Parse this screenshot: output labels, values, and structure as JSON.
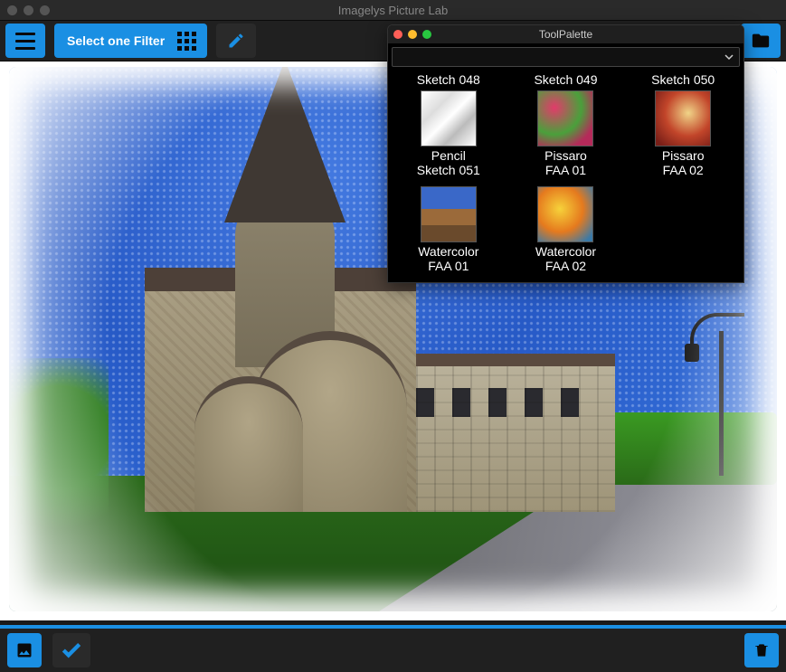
{
  "app": {
    "title": "Imagelys Picture Lab"
  },
  "toolbar": {
    "menu_icon": "hamburger-icon",
    "filter_label": "Select one Filter",
    "grid_icon": "grid-icon",
    "edit_icon": "pencil-icon",
    "folder_icon": "folder-icon"
  },
  "palette": {
    "title": "ToolPalette",
    "dropdown_value": "",
    "presets": [
      {
        "top": "Sketch 048",
        "l1": "Pencil",
        "l2": "Sketch 051",
        "thumb": "t048"
      },
      {
        "top": "Sketch 049",
        "l1": "Pissaro",
        "l2": "FAA 01",
        "thumb": "t049"
      },
      {
        "top": "Sketch 050",
        "l1": "Pissaro",
        "l2": "FAA 02",
        "thumb": "t050"
      },
      {
        "top": "",
        "l1": "Watercolor",
        "l2": "FAA 01",
        "thumb": "t051"
      },
      {
        "top": "",
        "l1": "Watercolor",
        "l2": "FAA 02",
        "thumb": "t052"
      }
    ]
  },
  "bottombar": {
    "image_icon": "image-icon",
    "apply_icon": "check-icon",
    "trash_icon": "trash-icon"
  },
  "colors": {
    "accent": "#1a8fe3"
  }
}
